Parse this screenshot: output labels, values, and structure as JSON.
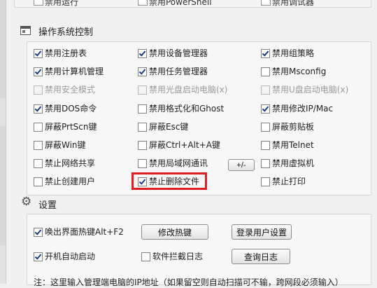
{
  "top_row": [
    "禁用运行",
    "禁用PowerShell",
    "禁用调试器"
  ],
  "os_control": {
    "title": "操作系统控制",
    "items": [
      {
        "label": "禁用注册表",
        "checked": true,
        "disabled": false
      },
      {
        "label": "禁用设备管理器",
        "checked": true,
        "disabled": false
      },
      {
        "label": "禁用组策略",
        "checked": true,
        "disabled": false
      },
      {
        "label": "禁用计算机管理",
        "checked": true,
        "disabled": false
      },
      {
        "label": "禁用任务管理器",
        "checked": true,
        "disabled": false
      },
      {
        "label": "禁用Msconfig",
        "checked": false,
        "disabled": false
      },
      {
        "label": "禁用安全模式",
        "checked": false,
        "disabled": true
      },
      {
        "label": "禁用光盘启动电脑(x)",
        "checked": false,
        "disabled": true
      },
      {
        "label": "禁用U盘启动电脑(x)",
        "checked": false,
        "disabled": true
      },
      {
        "label": "禁用DOS命令",
        "checked": true,
        "disabled": false
      },
      {
        "label": "禁用格式化和Ghost",
        "checked": false,
        "disabled": false
      },
      {
        "label": "禁用修改IP/Mac",
        "checked": true,
        "disabled": false
      },
      {
        "label": "屏蔽PrtScn键",
        "checked": false,
        "disabled": false
      },
      {
        "label": "屏蔽Esc键",
        "checked": false,
        "disabled": false
      },
      {
        "label": "屏蔽剪贴板",
        "checked": false,
        "disabled": false
      },
      {
        "label": "屏蔽Win键",
        "checked": false,
        "disabled": false
      },
      {
        "label": "屏蔽Ctrl+Alt+A键",
        "checked": false,
        "disabled": false
      },
      {
        "label": "禁用Telnet",
        "checked": false,
        "disabled": false
      },
      {
        "label": "禁止网络共享",
        "checked": false,
        "disabled": false
      },
      {
        "label": "禁用局域网通讯",
        "checked": false,
        "disabled": false
      },
      {
        "label": "禁用虚拟机",
        "checked": false,
        "disabled": false
      },
      {
        "label": "禁止创建用户",
        "checked": false,
        "disabled": false
      },
      {
        "label": "禁止删除文件",
        "checked": true,
        "disabled": false
      },
      {
        "label": "禁止打印",
        "checked": false,
        "disabled": false
      }
    ],
    "plus_minus_label": "+/-"
  },
  "settings": {
    "title": "设置",
    "hotkey_label": "唤出界面热键Alt+F2",
    "hotkey_checked": true,
    "modify_hotkey": "修改热键",
    "login_settings": "登录用户设置",
    "autostart_label": "开机自动启动",
    "autostart_checked": true,
    "intercept_log_label": "软件拦截日志",
    "intercept_log_checked": false,
    "query_log": "查询日志",
    "note": "注：这里输入管理端电脑的IP地址（如果留空则自动扫描可不输，跨网段必须输入）"
  },
  "colors": {
    "highlight": "#e02020",
    "check": "#1a3f8a"
  }
}
